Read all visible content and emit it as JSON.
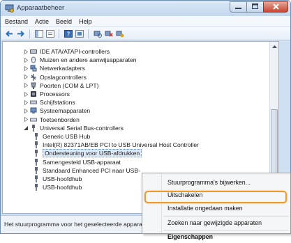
{
  "window": {
    "title": "Apparaatbeheer"
  },
  "menu": [
    "Bestand",
    "Actie",
    "Beeld",
    "Help"
  ],
  "toolbar_icons": [
    "back-icon",
    "forward-icon",
    "show-hide-tree-icon",
    "properties-icon",
    "help-icon",
    "update-driver-icon",
    "scan-hardware-icon",
    "uninstall-icon",
    "disable-icon"
  ],
  "tree": [
    {
      "label": "IDE ATA/ATAPI-controllers",
      "icon": "ide-controller-icon",
      "expanded": false
    },
    {
      "label": "Muizen en andere aanwijsapparaten",
      "icon": "mouse-icon",
      "expanded": false
    },
    {
      "label": "Netwerkadapters",
      "icon": "network-adapter-icon",
      "expanded": false
    },
    {
      "label": "Opslagcontrollers",
      "icon": "storage-controller-icon",
      "expanded": false
    },
    {
      "label": "Poorten (COM & LPT)",
      "icon": "port-icon",
      "expanded": false
    },
    {
      "label": "Processors",
      "icon": "processor-icon",
      "expanded": false
    },
    {
      "label": "Schijfstations",
      "icon": "disk-drive-icon",
      "expanded": false
    },
    {
      "label": "Systeemapparaten",
      "icon": "system-device-icon",
      "expanded": false
    },
    {
      "label": "Toetsenborden",
      "icon": "keyboard-icon",
      "expanded": false
    },
    {
      "label": "Universal Serial Bus-controllers",
      "icon": "usb-controller-icon",
      "expanded": true
    },
    {
      "label": "Generic USB Hub",
      "icon": "usb-plug-icon",
      "child": true
    },
    {
      "label": "Intel(R) 82371AB/EB PCI to USB Universal Host Controller",
      "icon": "usb-plug-icon",
      "child": true
    },
    {
      "label": "Ondersteuning voor USB-afdrukken",
      "icon": "usb-plug-icon",
      "child": true,
      "selected": true
    },
    {
      "label": "Samengesteld USB-apparaat",
      "icon": "usb-plug-icon",
      "child": true
    },
    {
      "label": "Standaard Enhanced PCI naar USB-",
      "icon": "usb-plug-icon",
      "child": true
    },
    {
      "label": "USB-hoofdhub",
      "icon": "usb-plug-icon",
      "child": true
    },
    {
      "label": "USB-hoofdhub",
      "icon": "usb-plug-icon",
      "child": true
    }
  ],
  "status": {
    "text": "Het stuurprogramma voor het geselecteerde apparaat"
  },
  "context_menu": {
    "items": [
      {
        "label": "Stuurprogramma's bijwerken...",
        "bold": false
      },
      {
        "label": "Uitschakelen",
        "bold": false
      },
      {
        "label": "Installatie ongedaan maken",
        "bold": false,
        "highlighted": true
      },
      {
        "label": "Zoeken naar gewijzigde apparaten",
        "bold": false
      },
      {
        "label": "Eigenschappen",
        "bold": true
      }
    ]
  },
  "colors": {
    "highlight_ring": "#ef9a2a",
    "close_button": "#c8452f",
    "window_frame": "#cfe0f2"
  }
}
